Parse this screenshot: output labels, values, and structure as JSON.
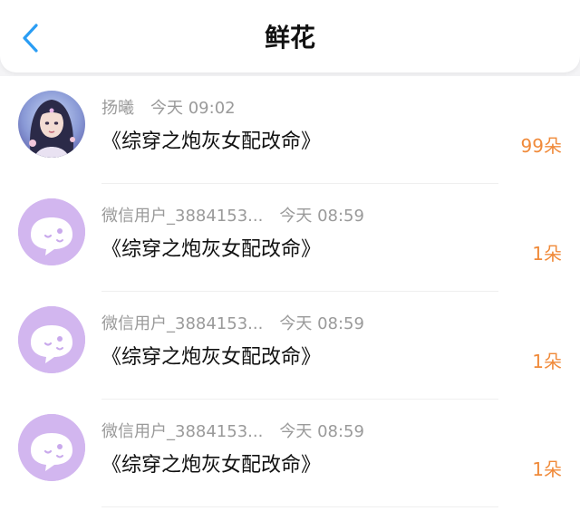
{
  "header": {
    "title": "鲜花",
    "back_icon": "chevron-left-icon",
    "accent_color": "#2a9df4"
  },
  "list": {
    "count_color": "#f08a3a",
    "items": [
      {
        "user": "扬曦",
        "time": "今天 09:02",
        "book": "《综穿之炮灰女配改命》",
        "count": "99朵",
        "avatar": "user-photo"
      },
      {
        "user": "微信用户_3884153...",
        "time": "今天 08:59",
        "book": "《综穿之炮灰女配改命》",
        "count": "1朵",
        "avatar": "default-chat-avatar-icon"
      },
      {
        "user": "微信用户_3884153...",
        "time": "今天 08:59",
        "book": "《综穿之炮灰女配改命》",
        "count": "1朵",
        "avatar": "default-chat-avatar-icon"
      },
      {
        "user": "微信用户_3884153...",
        "time": "今天 08:59",
        "book": "《综穿之炮灰女配改命》",
        "count": "1朵",
        "avatar": "default-chat-avatar-icon"
      }
    ]
  }
}
